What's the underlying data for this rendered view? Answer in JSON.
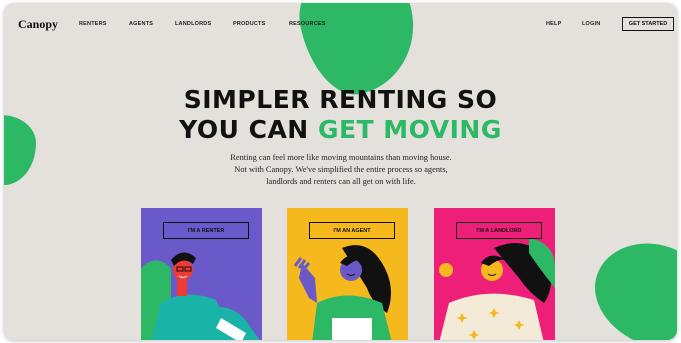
{
  "header": {
    "logo": "Canopy",
    "nav_left": [
      "RENTERS",
      "AGENTS",
      "LANDLORDS",
      "PRODUCTS",
      "RESOURCES"
    ],
    "nav_right": [
      "HELP",
      "LOGIN"
    ],
    "cta": "GET STARTED"
  },
  "hero": {
    "headline_line1": "SIMPLER RENTING SO",
    "headline_line2_prefix": "YOU CAN ",
    "headline_line2_highlight": "GET MOVING",
    "subtext_line1": "Renting can feel more like moving mountains than moving house.",
    "subtext_line2": "Not with Canopy. We've simplified the entire process so agents,",
    "subtext_line3": "landlords and renters can all get on with life."
  },
  "cards": {
    "renter": {
      "label": "I'M A RENTER",
      "color": "#6a5ac9"
    },
    "agent": {
      "label": "I'M AN AGENT",
      "color": "#f5b91e"
    },
    "landlord": {
      "label": "I'M A LANDLORD",
      "color": "#ee1f78"
    }
  },
  "colors": {
    "accent": "#2db866",
    "background": "#e4e1dc"
  }
}
